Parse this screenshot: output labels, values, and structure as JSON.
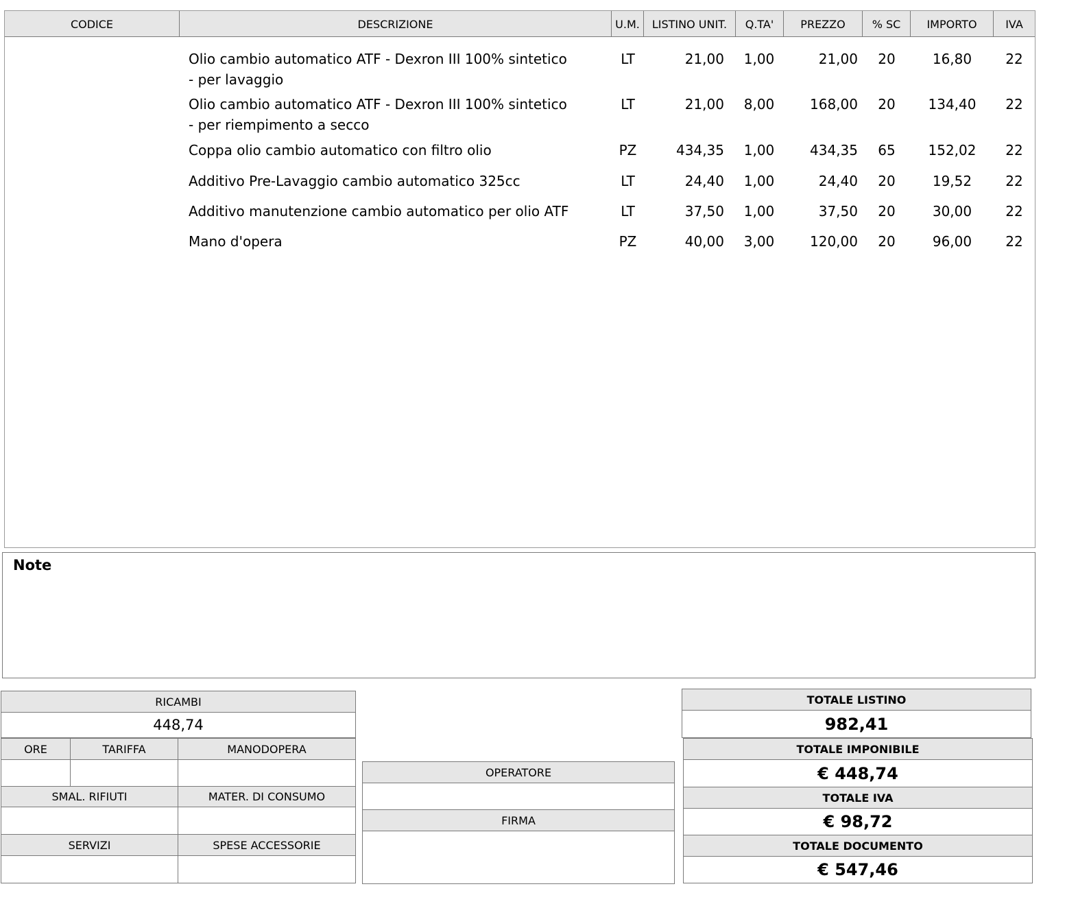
{
  "table": {
    "headers": {
      "codice": "CODICE",
      "descrizione": "DESCRIZIONE",
      "um": "U.M.",
      "listino": "LISTINO UNIT.",
      "qta": "Q.TA'",
      "prezzo": "PREZZO",
      "sc": "% SC",
      "importo": "IMPORTO",
      "iva": "IVA"
    },
    "rows": [
      {
        "codice": "",
        "descrizione": "Olio cambio automatico ATF - Dexron III 100% sintetico - per lavaggio",
        "um": "LT",
        "listino": "21,00",
        "qta": "1,00",
        "prezzo": "21,00",
        "sc": "20",
        "importo": "16,80",
        "iva": "22"
      },
      {
        "codice": "",
        "descrizione": "Olio cambio automatico ATF - Dexron III 100% sintetico - per riempimento a secco",
        "um": "LT",
        "listino": "21,00",
        "qta": "8,00",
        "prezzo": "168,00",
        "sc": "20",
        "importo": "134,40",
        "iva": "22"
      },
      {
        "codice": "",
        "descrizione": "Coppa olio cambio automatico con filtro olio",
        "um": "PZ",
        "listino": "434,35",
        "qta": "1,00",
        "prezzo": "434,35",
        "sc": "65",
        "importo": "152,02",
        "iva": "22"
      },
      {
        "codice": "",
        "descrizione": "Additivo Pre-Lavaggio cambio automatico 325cc",
        "um": "LT",
        "listino": "24,40",
        "qta": "1,00",
        "prezzo": "24,40",
        "sc": "20",
        "importo": "19,52",
        "iva": "22"
      },
      {
        "codice": "",
        "descrizione": "Additivo manutenzione cambio automatico per olio ATF",
        "um": "LT",
        "listino": "37,50",
        "qta": "1,00",
        "prezzo": "37,50",
        "sc": "20",
        "importo": "30,00",
        "iva": "22"
      },
      {
        "codice": "",
        "descrizione": "Mano d'opera",
        "um": "PZ",
        "listino": "40,00",
        "qta": "3,00",
        "prezzo": "120,00",
        "sc": "20",
        "importo": "96,00",
        "iva": "22"
      }
    ]
  },
  "notes": {
    "label": "Note",
    "text": ""
  },
  "costs": {
    "ricambi_label": "RICAMBI",
    "ricambi_value": "448,74",
    "ore_label": "ORE",
    "tariffa_label": "TARIFFA",
    "manodopera_label": "MANODOPERA",
    "smal_label": "SMAL. RIFIUTI",
    "mater_label": "MATER. DI CONSUMO",
    "servizi_label": "SERVIZI",
    "spese_label": "SPESE ACCESSORIE"
  },
  "sign": {
    "operatore_label": "OPERATORE",
    "firma_label": "FIRMA"
  },
  "totals": {
    "listino_label": "TOTALE LISTINO",
    "listino_value": "982,41",
    "imponibile_label": "TOTALE IMPONIBILE",
    "imponibile_value": "€  448,74",
    "iva_label": "TOTALE IVA",
    "iva_value": "€  98,72",
    "documento_label": "TOTALE DOCUMENTO",
    "documento_value": "€  547,46"
  }
}
